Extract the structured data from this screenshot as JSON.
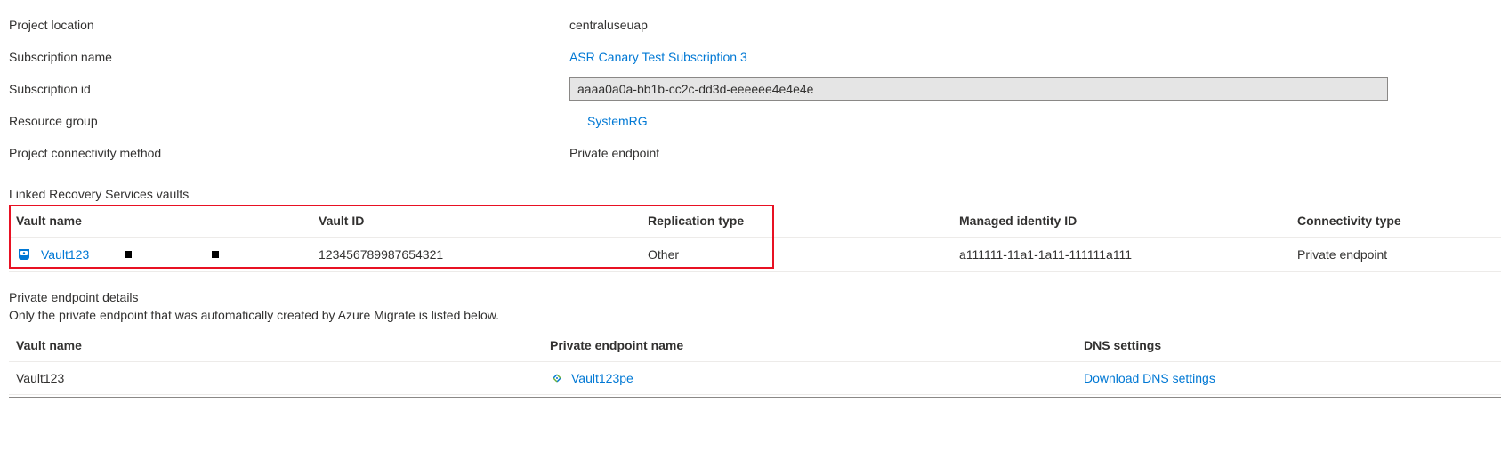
{
  "props": {
    "projectLocation": {
      "label": "Project location",
      "value": "centraluseuap"
    },
    "subscriptionName": {
      "label": "Subscription name",
      "value": "ASR Canary Test Subscription 3"
    },
    "subscriptionId": {
      "label": "Subscription id",
      "value": "aaaa0a0a-bb1b-cc2c-dd3d-eeeeee4e4e4e"
    },
    "resourceGroup": {
      "label": "Resource group",
      "value": "SystemRG"
    },
    "connectivityMethod": {
      "label": "Project connectivity method",
      "value": "Private endpoint"
    }
  },
  "linkedVaults": {
    "title": "Linked Recovery Services vaults",
    "headers": {
      "vaultName": "Vault name",
      "vaultId": "Vault ID",
      "replicationType": "Replication type",
      "managedIdentityId": "Managed identity ID",
      "connectivityType": "Connectivity type"
    },
    "rows": [
      {
        "vaultName": "Vault123",
        "vaultId": "123456789987654321",
        "replicationType": "Other",
        "managedIdentityId": "a111111-11a1-1a11-111111a111",
        "connectivityType": "Private endpoint"
      }
    ]
  },
  "privateEndpoints": {
    "title": "Private endpoint details",
    "description": "Only the private endpoint that was automatically created by Azure Migrate is listed below.",
    "headers": {
      "vaultName": "Vault name",
      "peName": "Private endpoint name",
      "dnsSettings": "DNS settings"
    },
    "rows": [
      {
        "vaultName": "Vault123",
        "peName": "Vault123pe",
        "dnsSettings": "Download DNS settings"
      }
    ]
  }
}
